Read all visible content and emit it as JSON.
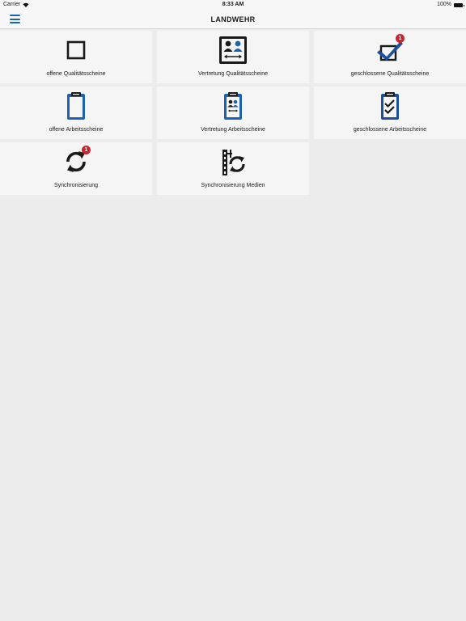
{
  "status_bar": {
    "carrier": "Carrier",
    "time": "8:33 AM",
    "battery": "100%"
  },
  "nav": {
    "title": "LANDWEHR",
    "menu_icon": "hamburger-menu-icon"
  },
  "colors": {
    "accent": "#1b63b0",
    "badge": "#c8262c",
    "icon_dark": "#1a1a1a"
  },
  "tiles": [
    {
      "label": "offene Qualitätsscheine",
      "icon": "empty-checkbox-icon"
    },
    {
      "label": "Vertretung Qualitätsscheine",
      "icon": "substitution-people-icon"
    },
    {
      "label": "geschlossene Qualitätsscheine",
      "icon": "checked-checkbox-icon",
      "badge": "1"
    },
    {
      "label": "offene Arbeitsscheine",
      "icon": "empty-clipboard-icon"
    },
    {
      "label": "Vertretung Arbeitsscheine",
      "icon": "clipboard-people-icon"
    },
    {
      "label": "geschlossene Arbeitsscheine",
      "icon": "clipboard-checklist-icon"
    },
    {
      "label": "Synchronisierung",
      "icon": "sync-icon",
      "badge": "1"
    },
    {
      "label": "Synchronisierung Medien",
      "icon": "media-sync-icon"
    }
  ]
}
